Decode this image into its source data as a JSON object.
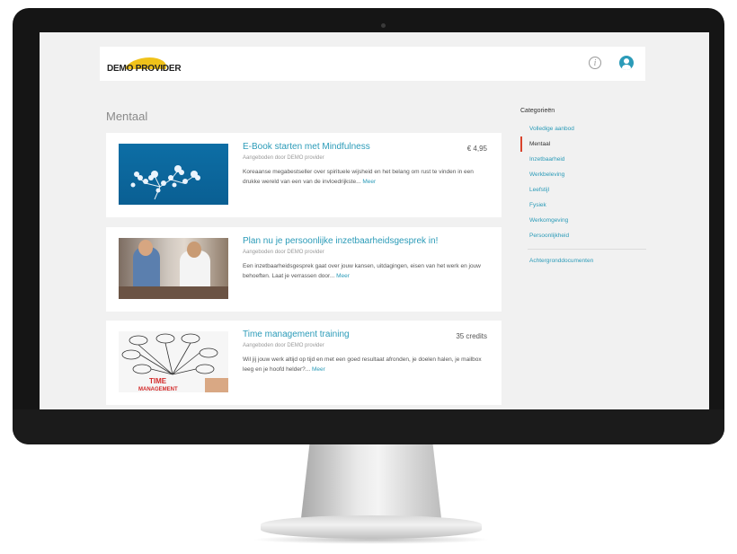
{
  "header": {
    "logo_text": "DEMO PROVIDER",
    "info_icon": "info-icon",
    "user_icon": "user-account-icon"
  },
  "page": {
    "title": "Mentaal"
  },
  "cards": [
    {
      "title": "E-Book starten met Mindfulness",
      "provider": "Aangeboden door DEMO provider",
      "price": "€ 4,95",
      "description": "Koreaanse megabestseller over spirituele wijsheid en het belang om rust te vinden in een drukke wereld van een van de invloedrijkste...",
      "more": "Meer"
    },
    {
      "title": "Plan nu je persoonlijke inzetbaarheidsgesprek in!",
      "provider": "Aangeboden door DEMO provider",
      "price": "",
      "description": "Een inzetbaarheidsgesprek gaat over jouw kansen, uitdagingen, eisen van het werk en jouw behoeften. Laat je verrassen door...",
      "more": "Meer"
    },
    {
      "title": "Time management training",
      "provider": "Aangeboden door DEMO provider",
      "price": "35 credits",
      "description": "Wil jij jouw werk altijd op tijd en met een goed resultaat afronden, je doelen halen, je mailbox leeg en je hoofd helder?...",
      "more": "Meer"
    }
  ],
  "sidebar": {
    "heading": "Categorieën",
    "items": [
      {
        "label": "Volledige aanbod",
        "active": false
      },
      {
        "label": "Mentaal",
        "active": true
      },
      {
        "label": "Inzetbaarheid",
        "active": false
      },
      {
        "label": "Werkbeleving",
        "active": false
      },
      {
        "label": "Leefstijl",
        "active": false
      },
      {
        "label": "Fysiek",
        "active": false
      },
      {
        "label": "Werkomgeving",
        "active": false
      },
      {
        "label": "Persoonlijkheid",
        "active": false
      }
    ],
    "extra_link": "Achtergronddocumenten"
  },
  "colors": {
    "accent": "#2b9bb8",
    "active_marker": "#d9432c",
    "logo_yellow": "#f0c21a"
  }
}
